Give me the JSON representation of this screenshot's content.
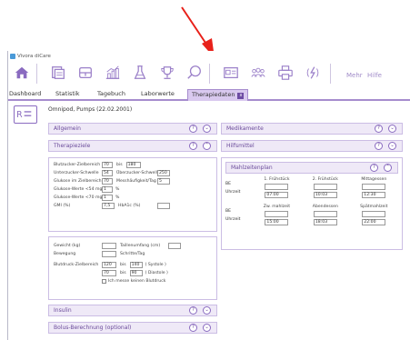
{
  "window": {
    "title": "Vivora diCare"
  },
  "toolbar": {
    "items": [
      {
        "icon": "home-icon"
      },
      {
        "icon": "dashboard-icon"
      },
      {
        "icon": "logbook-icon"
      },
      {
        "icon": "statistics-icon"
      },
      {
        "icon": "lab-flask-icon"
      },
      {
        "icon": "trophy-icon"
      },
      {
        "icon": "search-icon"
      },
      {
        "icon": "id-card-icon"
      },
      {
        "icon": "users-icon"
      },
      {
        "icon": "print-icon"
      },
      {
        "icon": "sync-icon"
      }
    ],
    "more_label": "Mehr",
    "help_label": "Hilfe"
  },
  "tabs": [
    {
      "label": "Dashboard"
    },
    {
      "label": "Statistik"
    },
    {
      "label": "Tagebuch"
    },
    {
      "label": "Laborwerte"
    },
    {
      "label": "Therapiedaten",
      "active": true
    }
  ],
  "tab_close": "x",
  "patient": {
    "name": "Omnipod, Pumps (22.02.2001)"
  },
  "icons": {
    "help": "?",
    "collapse": "⌃",
    "expand": "⌄"
  },
  "sections": {
    "allgemein": "Allgemein",
    "therapieziele": "Therapieziele",
    "insulin": "Insulin",
    "bolus": "Bolus-Berechnung (optional)",
    "medikamente": "Medikamente",
    "hilfsmittel": "Hilfsmittel",
    "mahlzeitenplan": "Mahlzeitenplan"
  },
  "therapieziele": {
    "bz_label": "Blutzucker-Zielbereich",
    "bz_from": "70",
    "bz_bis": "bis",
    "bz_to": "180",
    "unter_label": "Unterzucker-Schwelle",
    "unter_val": "54",
    "ueber_label": "Überzucker-Schwelle",
    "ueber_val": "250",
    "gluk_zb_label": "Glukose im Zielbereich (%)",
    "gluk_zb_val": "70",
    "mess_label": "Messhäufigkeit/Tag",
    "mess_val": "5",
    "gluk54_label": "Glukose-Werte <54 mg/dL",
    "gluk54_val": "1",
    "gluk54_unit": "%",
    "gluk70_label": "Glukose-Werte <70 mg/dL",
    "gluk70_val": "1",
    "gluk70_unit": "%",
    "gmi_label": "GMI (%)",
    "gmi_val": "7,5",
    "hba1c_label": "HbA1c (%)",
    "hba1c_val": "",
    "gewicht_label": "Gewicht (kg)",
    "gewicht_val": "",
    "taille_label": "Taillenumfang (cm)",
    "taille_val": "",
    "bewegung_label": "Bewegung",
    "bewegung_val": "",
    "schritte_label": "Schritte/Tag",
    "bd_label": "Blutdruck-Zielbereich",
    "bd_sys_from": "120",
    "bd_sys_to": "140",
    "bd_sys_unit": "( Systole )",
    "bd_dia_from": "70",
    "bd_dia_to": "90",
    "bd_dia_unit": "( Diastole )",
    "bd_bis": "bis",
    "no_bd_label": "Ich messe keinen Blutdruck"
  },
  "mahlzeitenplan": {
    "be_label": "BE",
    "uhrzeit_label": "Uhrzeit",
    "row1": [
      {
        "name": "1. Frühstück",
        "time": "07:00"
      },
      {
        "name": "2. Frühstück",
        "time": "10:03"
      },
      {
        "name": "Mittagessen",
        "time": "12:30"
      }
    ],
    "row2": [
      {
        "name": "Zw. mahlzeit",
        "time": "15:00"
      },
      {
        "name": "Abendessen",
        "time": "18:03"
      },
      {
        "name": "Spätmahlzeit",
        "time": "22:00"
      }
    ]
  },
  "colors": {
    "accent": "#a68cce",
    "arrow": "#e8211a",
    "header_bg": "#efe9f7"
  }
}
